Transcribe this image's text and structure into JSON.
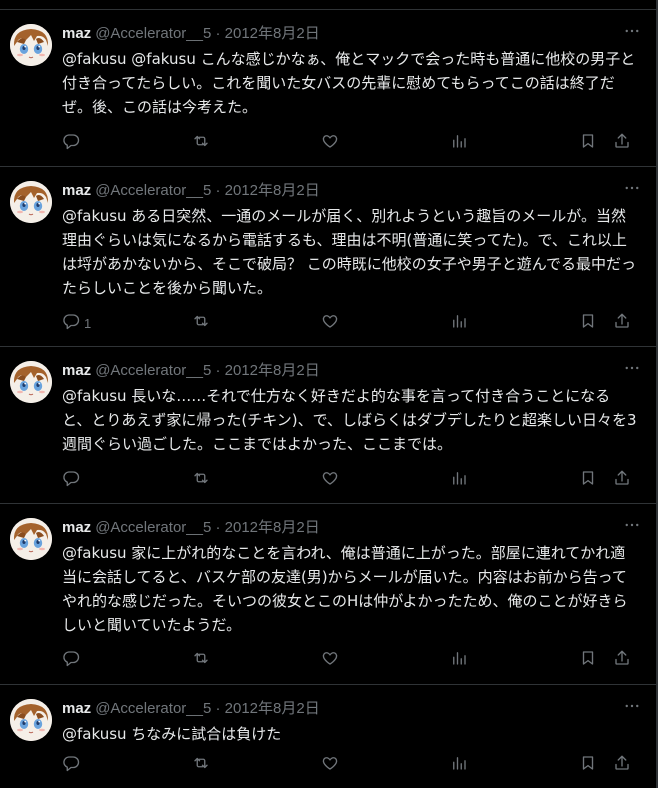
{
  "tweets": [
    {
      "name": "maz",
      "handle": "@Accelerator__5",
      "separator": "·",
      "date": "2012年8月2日",
      "text": "@fakusu @fakusu こんな感じかなぁ、俺とマックで会った時も普通に他校の男子と付き合ってたらしい。これを聞いた女バスの先輩に慰めてもらってこの話は終了だぜ。後、この話は今考えた。",
      "reply_count": ""
    },
    {
      "name": "maz",
      "handle": "@Accelerator__5",
      "separator": "·",
      "date": "2012年8月2日",
      "text": "@fakusu ある日突然、一通のメールが届く、別れようという趣旨のメールが。当然理由ぐらいは気になるから電話するも、理由は不明(普通に笑ってた)。で、これ以上は埒があかないから、そこで破局？ この時既に他校の女子や男子と遊んでる最中だったらしいことを後から聞いた。",
      "reply_count": "1"
    },
    {
      "name": "maz",
      "handle": "@Accelerator__5",
      "separator": "·",
      "date": "2012年8月2日",
      "text": "@fakusu 長いな……それで仕方なく好きだよ的な事を言って付き合うことになると、とりあえず家に帰った(チキン)、で、しばらくはダブデしたりと超楽しい日々を3週間ぐらい過ごした。ここまではよかった、ここまでは。",
      "reply_count": ""
    },
    {
      "name": "maz",
      "handle": "@Accelerator__5",
      "separator": "·",
      "date": "2012年8月2日",
      "text": "@fakusu 家に上がれ的なことを言われ、俺は普通に上がった。部屋に連れてかれ適当に会話してると、バスケ部の友達(男)からメールが届いた。内容はお前から告ってやれ的な感じだった。そいつの彼女とこのHは仲がよかったため、俺のことが好きらしいと聞いていたようだ。",
      "reply_count": ""
    },
    {
      "name": "maz",
      "handle": "@Accelerator__5",
      "separator": "·",
      "date": "2012年8月2日",
      "text": "@fakusu ちなみに試合は負けた",
      "reply_count": ""
    }
  ],
  "icons": [
    "reply-icon",
    "retweet-icon",
    "like-icon",
    "views-icon",
    "bookmark-icon",
    "share-icon",
    "more-icon"
  ],
  "colors": {
    "background": "#000000",
    "text": "#e7e9ea",
    "muted": "#71767b",
    "divider": "#2f3336"
  }
}
